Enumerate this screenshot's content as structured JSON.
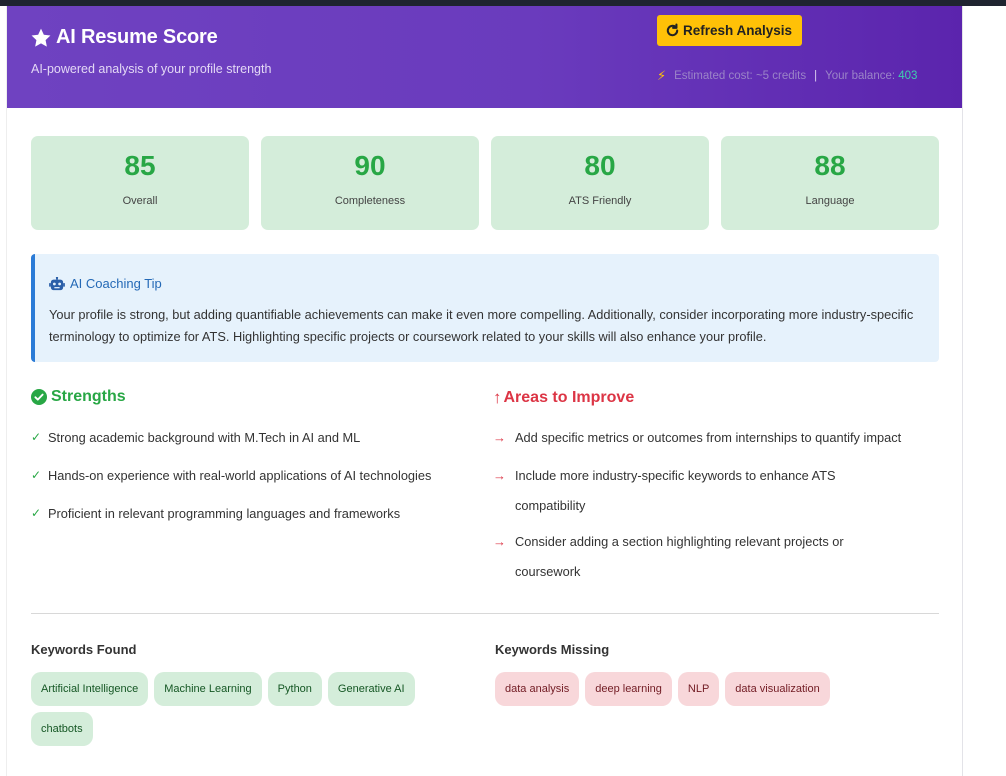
{
  "header": {
    "title": "AI Resume Score",
    "subtitle": "AI-powered analysis of your profile strength",
    "refresh_label": "Refresh Analysis",
    "cost_text": "Estimated cost: ~5 credits",
    "separator": "|",
    "balance_label": "Your balance:",
    "balance_value": "403"
  },
  "scores": [
    {
      "value": "85",
      "label": "Overall"
    },
    {
      "value": "90",
      "label": "Completeness"
    },
    {
      "value": "80",
      "label": "ATS Friendly"
    },
    {
      "value": "88",
      "label": "Language"
    }
  ],
  "tip": {
    "title": "AI Coaching Tip",
    "text": "Your profile is strong, but adding quantifiable achievements can make it even more compelling. Additionally, consider incorporating more industry-specific terminology to optimize for ATS. Highlighting specific projects or coursework related to your skills will also enhance your profile."
  },
  "strengths": {
    "title": "Strengths",
    "items": [
      "Strong academic background with M.Tech in AI and ML",
      "Hands-on experience with real-world applications of AI technologies",
      "Proficient in relevant programming languages and frameworks"
    ]
  },
  "improve": {
    "title": "Areas to Improve",
    "items": [
      "Add specific metrics or outcomes from internships to quantify impact",
      "Include more industry-specific keywords to enhance ATS compatibility",
      "Consider adding a section highlighting relevant projects or coursework"
    ]
  },
  "keywords_found": {
    "title": "Keywords Found",
    "items": [
      "Artificial Intelligence",
      "Machine Learning",
      "Python",
      "Generative AI",
      "chatbots"
    ]
  },
  "keywords_missing": {
    "title": "Keywords Missing",
    "items": [
      "data analysis",
      "deep learning",
      "NLP",
      "data visualization"
    ]
  },
  "colors": {
    "header_gradient_start": "#6f42c1",
    "header_gradient_end": "#5b24ad",
    "accent_yellow": "#ffc107",
    "success": "#28a745",
    "danger": "#dc3545",
    "info": "#2b7bd6"
  },
  "icons": {
    "title": "star-icon",
    "refresh": "refresh-icon",
    "cost": "bolt-icon",
    "tip": "robot-icon",
    "strengths": "check-circle-icon",
    "improve": "up-arrow-icon"
  }
}
